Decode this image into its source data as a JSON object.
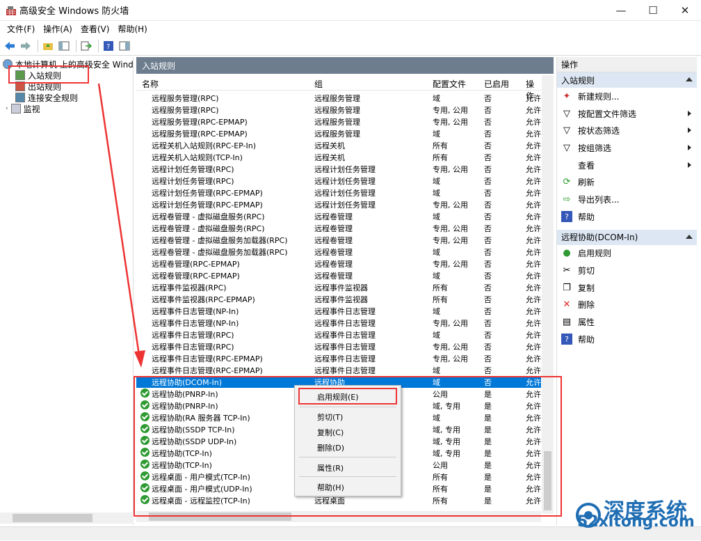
{
  "window": {
    "title": "高级安全 Windows 防火墙",
    "minimize": "—",
    "maximize": "☐",
    "close": "✕"
  },
  "menu": [
    "文件(F)",
    "操作(A)",
    "查看(V)",
    "帮助(H)"
  ],
  "tree": {
    "root": "本地计算机 上的高级安全 Wind",
    "items": [
      "入站规则",
      "出站规则",
      "连接安全规则",
      "监视"
    ]
  },
  "panel": {
    "title": "入站规则",
    "columns": [
      "名称",
      "组",
      "配置文件",
      "已启用",
      "操作"
    ]
  },
  "rows": [
    {
      "name": "远程服务管理(RPC)",
      "group": "远程服务管理",
      "profile": "域",
      "enabled": "否",
      "action": "允许",
      "check": false
    },
    {
      "name": "远程服务管理(RPC)",
      "group": "远程服务管理",
      "profile": "专用, 公用",
      "enabled": "否",
      "action": "允许",
      "check": false
    },
    {
      "name": "远程服务管理(RPC-EPMAP)",
      "group": "远程服务管理",
      "profile": "专用, 公用",
      "enabled": "否",
      "action": "允许",
      "check": false
    },
    {
      "name": "远程服务管理(RPC-EPMAP)",
      "group": "远程服务管理",
      "profile": "域",
      "enabled": "否",
      "action": "允许",
      "check": false
    },
    {
      "name": "远程关机入站规则(RPC-EP-In)",
      "group": "远程关机",
      "profile": "所有",
      "enabled": "否",
      "action": "允许",
      "check": false
    },
    {
      "name": "远程关机入站规则(TCP-In)",
      "group": "远程关机",
      "profile": "所有",
      "enabled": "否",
      "action": "允许",
      "check": false
    },
    {
      "name": "远程计划任务管理(RPC)",
      "group": "远程计划任务管理",
      "profile": "专用, 公用",
      "enabled": "否",
      "action": "允许",
      "check": false
    },
    {
      "name": "远程计划任务管理(RPC)",
      "group": "远程计划任务管理",
      "profile": "域",
      "enabled": "否",
      "action": "允许",
      "check": false
    },
    {
      "name": "远程计划任务管理(RPC-EPMAP)",
      "group": "远程计划任务管理",
      "profile": "域",
      "enabled": "否",
      "action": "允许",
      "check": false
    },
    {
      "name": "远程计划任务管理(RPC-EPMAP)",
      "group": "远程计划任务管理",
      "profile": "专用, 公用",
      "enabled": "否",
      "action": "允许",
      "check": false
    },
    {
      "name": "远程卷管理 - 虚拟磁盘服务(RPC)",
      "group": "远程卷管理",
      "profile": "域",
      "enabled": "否",
      "action": "允许",
      "check": false
    },
    {
      "name": "远程卷管理 - 虚拟磁盘服务(RPC)",
      "group": "远程卷管理",
      "profile": "专用, 公用",
      "enabled": "否",
      "action": "允许",
      "check": false
    },
    {
      "name": "远程卷管理 - 虚拟磁盘服务加载器(RPC)",
      "group": "远程卷管理",
      "profile": "专用, 公用",
      "enabled": "否",
      "action": "允许",
      "check": false
    },
    {
      "name": "远程卷管理 - 虚拟磁盘服务加载器(RPC)",
      "group": "远程卷管理",
      "profile": "域",
      "enabled": "否",
      "action": "允许",
      "check": false
    },
    {
      "name": "远程卷管理(RPC-EPMAP)",
      "group": "远程卷管理",
      "profile": "专用, 公用",
      "enabled": "否",
      "action": "允许",
      "check": false
    },
    {
      "name": "远程卷管理(RPC-EPMAP)",
      "group": "远程卷管理",
      "profile": "域",
      "enabled": "否",
      "action": "允许",
      "check": false
    },
    {
      "name": "远程事件监视器(RPC)",
      "group": "远程事件监视器",
      "profile": "所有",
      "enabled": "否",
      "action": "允许",
      "check": false
    },
    {
      "name": "远程事件监视器(RPC-EPMAP)",
      "group": "远程事件监视器",
      "profile": "所有",
      "enabled": "否",
      "action": "允许",
      "check": false
    },
    {
      "name": "远程事件日志管理(NP-In)",
      "group": "远程事件日志管理",
      "profile": "域",
      "enabled": "否",
      "action": "允许",
      "check": false
    },
    {
      "name": "远程事件日志管理(NP-In)",
      "group": "远程事件日志管理",
      "profile": "专用, 公用",
      "enabled": "否",
      "action": "允许",
      "check": false
    },
    {
      "name": "远程事件日志管理(RPC)",
      "group": "远程事件日志管理",
      "profile": "域",
      "enabled": "否",
      "action": "允许",
      "check": false
    },
    {
      "name": "远程事件日志管理(RPC)",
      "group": "远程事件日志管理",
      "profile": "专用, 公用",
      "enabled": "否",
      "action": "允许",
      "check": false
    },
    {
      "name": "远程事件日志管理(RPC-EPMAP)",
      "group": "远程事件日志管理",
      "profile": "专用, 公用",
      "enabled": "否",
      "action": "允许",
      "check": false
    },
    {
      "name": "远程事件日志管理(RPC-EPMAP)",
      "group": "远程事件日志管理",
      "profile": "域",
      "enabled": "否",
      "action": "允许",
      "check": false
    },
    {
      "name": "远程协助(DCOM-In)",
      "group": "远程协助",
      "profile": "域",
      "enabled": "否",
      "action": "允许",
      "check": false,
      "selected": true
    },
    {
      "name": "远程协助(PNRP-In)",
      "group": "",
      "profile": "公用",
      "enabled": "是",
      "action": "允许",
      "check": true
    },
    {
      "name": "远程协助(PNRP-In)",
      "group": "",
      "profile": "域, 专用",
      "enabled": "是",
      "action": "允许",
      "check": true
    },
    {
      "name": "远程协助(RA 服务器 TCP-In)",
      "group": "",
      "profile": "域",
      "enabled": "是",
      "action": "允许",
      "check": true
    },
    {
      "name": "远程协助(SSDP TCP-In)",
      "group": "",
      "profile": "域, 专用",
      "enabled": "是",
      "action": "允许",
      "check": true
    },
    {
      "name": "远程协助(SSDP UDP-In)",
      "group": "",
      "profile": "域, 专用",
      "enabled": "是",
      "action": "允许",
      "check": true
    },
    {
      "name": "远程协助(TCP-In)",
      "group": "",
      "profile": "域, 专用",
      "enabled": "是",
      "action": "允许",
      "check": true
    },
    {
      "name": "远程协助(TCP-In)",
      "group": "",
      "profile": "公用",
      "enabled": "是",
      "action": "允许",
      "check": true
    },
    {
      "name": "远程桌面 - 用户模式(TCP-In)",
      "group": "",
      "profile": "所有",
      "enabled": "是",
      "action": "允许",
      "check": true
    },
    {
      "name": "远程桌面 - 用户模式(UDP-In)",
      "group": "",
      "profile": "所有",
      "enabled": "是",
      "action": "允许",
      "check": true
    },
    {
      "name": "远程桌面 - 远程监控(TCP-In)",
      "group": "远程桌面",
      "profile": "所有",
      "enabled": "是",
      "action": "允许",
      "check": true
    }
  ],
  "context_menu": [
    "启用规则(E)",
    "剪切(T)",
    "复制(C)",
    "删除(D)",
    "属性(R)",
    "帮助(H)"
  ],
  "actions": {
    "header": "操作",
    "section1": "入站规则",
    "items1": [
      "新建规则...",
      "按配置文件筛选",
      "按状态筛选",
      "按组筛选",
      "查看",
      "刷新",
      "导出列表...",
      "帮助"
    ],
    "section2": "远程协助(DCOM-In)",
    "items2": [
      "启用规则",
      "剪切",
      "复制",
      "删除",
      "属性",
      "帮助"
    ]
  },
  "watermark": {
    "line1": "深度系统",
    "line2": "52xitong.com"
  },
  "colors": {
    "selection": "#0078d7",
    "header": "#6d7d8e",
    "annotation": "#e33333",
    "enabled_check": "#2e9a31"
  }
}
